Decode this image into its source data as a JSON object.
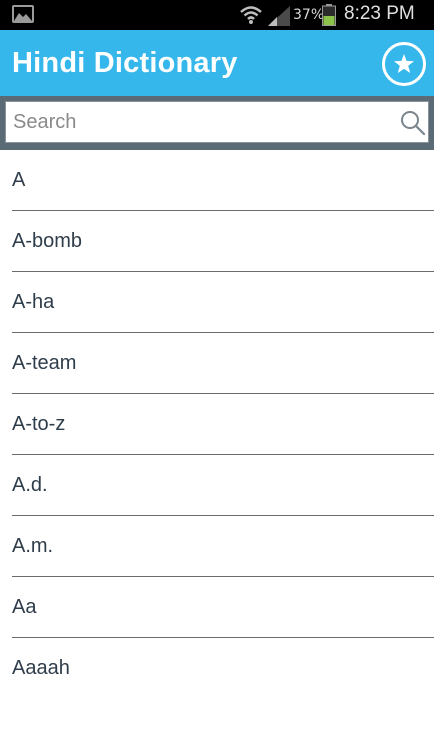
{
  "status_bar": {
    "battery_percent": "37%",
    "time": "8:23 PM",
    "icons": [
      "gallery-icon",
      "wifi-icon",
      "signal-icon",
      "battery-icon"
    ]
  },
  "action_bar": {
    "title": "Hindi Dictionary",
    "favorites_icon": "star-icon",
    "background": "#35b7ec"
  },
  "search": {
    "placeholder": "Search",
    "value": "",
    "icon": "search-icon"
  },
  "words": [
    "A",
    "A-bomb",
    "A-ha",
    "A-team",
    "A-to-z",
    "A.d.",
    "A.m.",
    "Aa",
    "Aaaah"
  ]
}
